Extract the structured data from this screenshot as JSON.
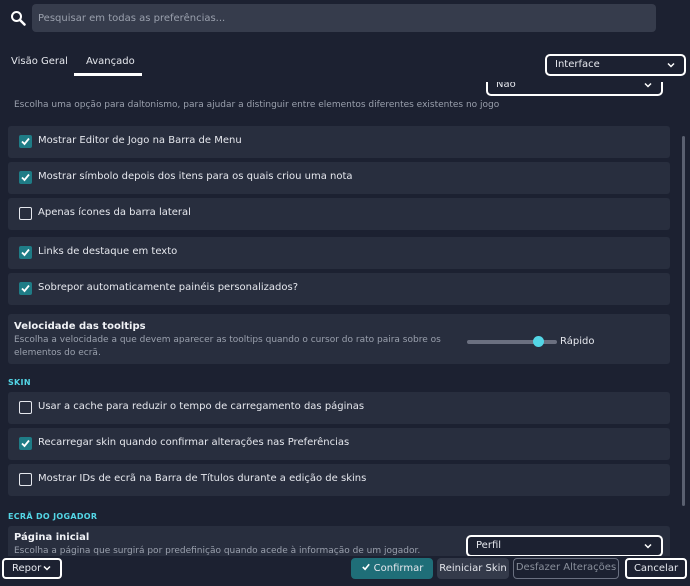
{
  "search": {
    "placeholder": "Pesquisar em todas as preferências..."
  },
  "tabs": [
    {
      "label": "Visão Geral",
      "active": false
    },
    {
      "label": "Avançado",
      "active": true
    }
  ],
  "category_select": {
    "value": "Interface"
  },
  "colorblind": {
    "select_value": "Não",
    "description": "Escolha uma opção para daltonismo, para ajudar a distinguir entre elementos diferentes existentes no jogo"
  },
  "interface_options": [
    {
      "label": "Mostrar Editor de Jogo na Barra de Menu",
      "checked": true
    },
    {
      "label": "Mostrar símbolo depois dos itens para os quais criou uma nota",
      "checked": true
    },
    {
      "label": "Apenas ícones da barra lateral",
      "checked": false
    },
    {
      "label": "Links de destaque em texto",
      "checked": true
    },
    {
      "label": "Sobrepor automaticamente painéis personalizados?",
      "checked": true
    }
  ],
  "tooltip_speed": {
    "title": "Velocidade das tooltips",
    "description": "Escolha a velocidade a que devem aparecer as tooltips quando o cursor do rato paira sobre os elementos do ecrã.",
    "value_label": "Rápido",
    "level": 0.75
  },
  "skin": {
    "heading": "SKIN",
    "options": [
      {
        "label": "Usar a cache para reduzir o tempo de carregamento das páginas",
        "checked": false
      },
      {
        "label": "Recarregar skin quando confirmar alterações nas Preferências",
        "checked": true
      },
      {
        "label": "Mostrar IDs de ecrã na Barra de Títulos durante a edição de skins",
        "checked": false
      }
    ]
  },
  "player_screen": {
    "heading": "ECRÃ DO JOGADOR",
    "title": "Página inicial",
    "description": "Escolha a página que surgirá por predefinição quando acede à informação de um jogador.",
    "select_value": "Perfil"
  },
  "footer": {
    "reset_label": "Repor",
    "confirm_label": "Confirmar",
    "reset_skin_label": "Reiniciar Skin",
    "undo_label": "Desfazer Alterações",
    "cancel_label": "Cancelar"
  },
  "colors": {
    "accent": "#53d6e6",
    "checkbox": "#1f7c86",
    "background": "#1c2131",
    "row": "#282e3e"
  }
}
